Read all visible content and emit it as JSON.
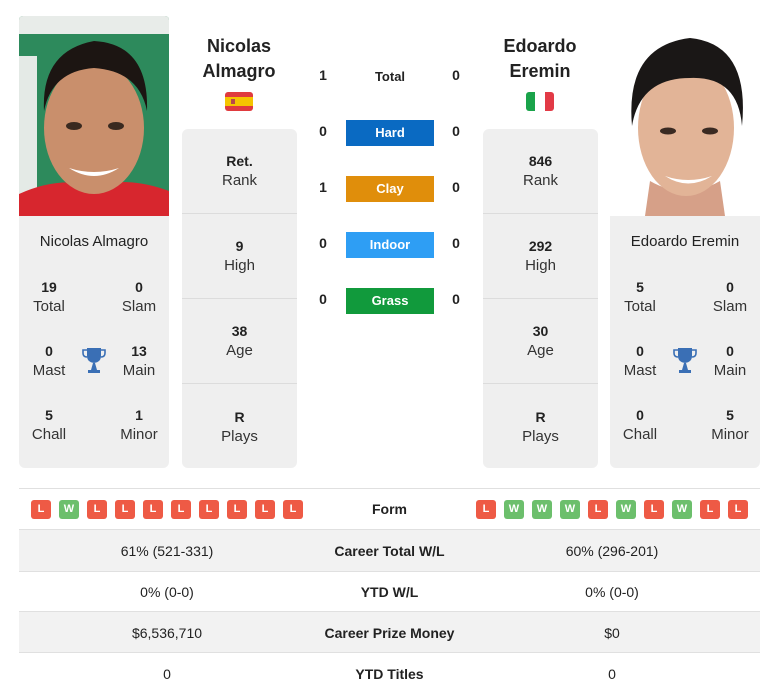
{
  "players": {
    "left": {
      "name_line1": "Nicolas",
      "name_line2": "Almagro",
      "full_name": "Nicolas Almagro",
      "country": "Spain",
      "flag_icon": "spain-flag-icon",
      "info": [
        {
          "value": "Ret.",
          "label": "Rank"
        },
        {
          "value": "9",
          "label": "High"
        },
        {
          "value": "38",
          "label": "Age"
        },
        {
          "value": "R",
          "label": "Plays"
        }
      ],
      "titles": {
        "total": {
          "value": "19",
          "label": "Total"
        },
        "slam": {
          "value": "0",
          "label": "Slam"
        },
        "mast": {
          "value": "0",
          "label": "Mast"
        },
        "main": {
          "value": "13",
          "label": "Main"
        },
        "chall": {
          "value": "5",
          "label": "Chall"
        },
        "minor": {
          "value": "1",
          "label": "Minor"
        }
      },
      "form": [
        "L",
        "W",
        "L",
        "L",
        "L",
        "L",
        "L",
        "L",
        "L",
        "L"
      ]
    },
    "right": {
      "name_line1": "Edoardo",
      "name_line2": "Eremin",
      "full_name": "Edoardo Eremin",
      "country": "Italy",
      "flag_icon": "italy-flag-icon",
      "info": [
        {
          "value": "846",
          "label": "Rank"
        },
        {
          "value": "292",
          "label": "High"
        },
        {
          "value": "30",
          "label": "Age"
        },
        {
          "value": "R",
          "label": "Plays"
        }
      ],
      "titles": {
        "total": {
          "value": "5",
          "label": "Total"
        },
        "slam": {
          "value": "0",
          "label": "Slam"
        },
        "mast": {
          "value": "0",
          "label": "Mast"
        },
        "main": {
          "value": "0",
          "label": "Main"
        },
        "chall": {
          "value": "0",
          "label": "Chall"
        },
        "minor": {
          "value": "5",
          "label": "Minor"
        }
      },
      "form": [
        "L",
        "W",
        "W",
        "W",
        "L",
        "W",
        "L",
        "W",
        "L",
        "L"
      ]
    }
  },
  "h2h": {
    "total": {
      "label": "Total",
      "left": "1",
      "right": "0"
    },
    "surfaces": [
      {
        "label": "Hard",
        "left": "0",
        "right": "0",
        "color": "#0a6ac2"
      },
      {
        "label": "Clay",
        "left": "1",
        "right": "0",
        "color": "#e08e0b"
      },
      {
        "label": "Indoor",
        "left": "0",
        "right": "0",
        "color": "#2e9ef4"
      },
      {
        "label": "Grass",
        "left": "0",
        "right": "0",
        "color": "#119a3c"
      }
    ]
  },
  "form_label": "Form",
  "stats": [
    {
      "label": "Career Total W/L",
      "left": "61% (521-331)",
      "right": "60% (296-201)"
    },
    {
      "label": "YTD W/L",
      "left": "0% (0-0)",
      "right": "0% (0-0)"
    },
    {
      "label": "Career Prize Money",
      "left": "$6,536,710",
      "right": "$0"
    },
    {
      "label": "YTD Titles",
      "left": "0",
      "right": "0"
    }
  ],
  "colors": {
    "loss": "#ee5a45",
    "win": "#6cbf6c",
    "trophy": "#3a6fb5",
    "card_bg": "#efefef"
  }
}
